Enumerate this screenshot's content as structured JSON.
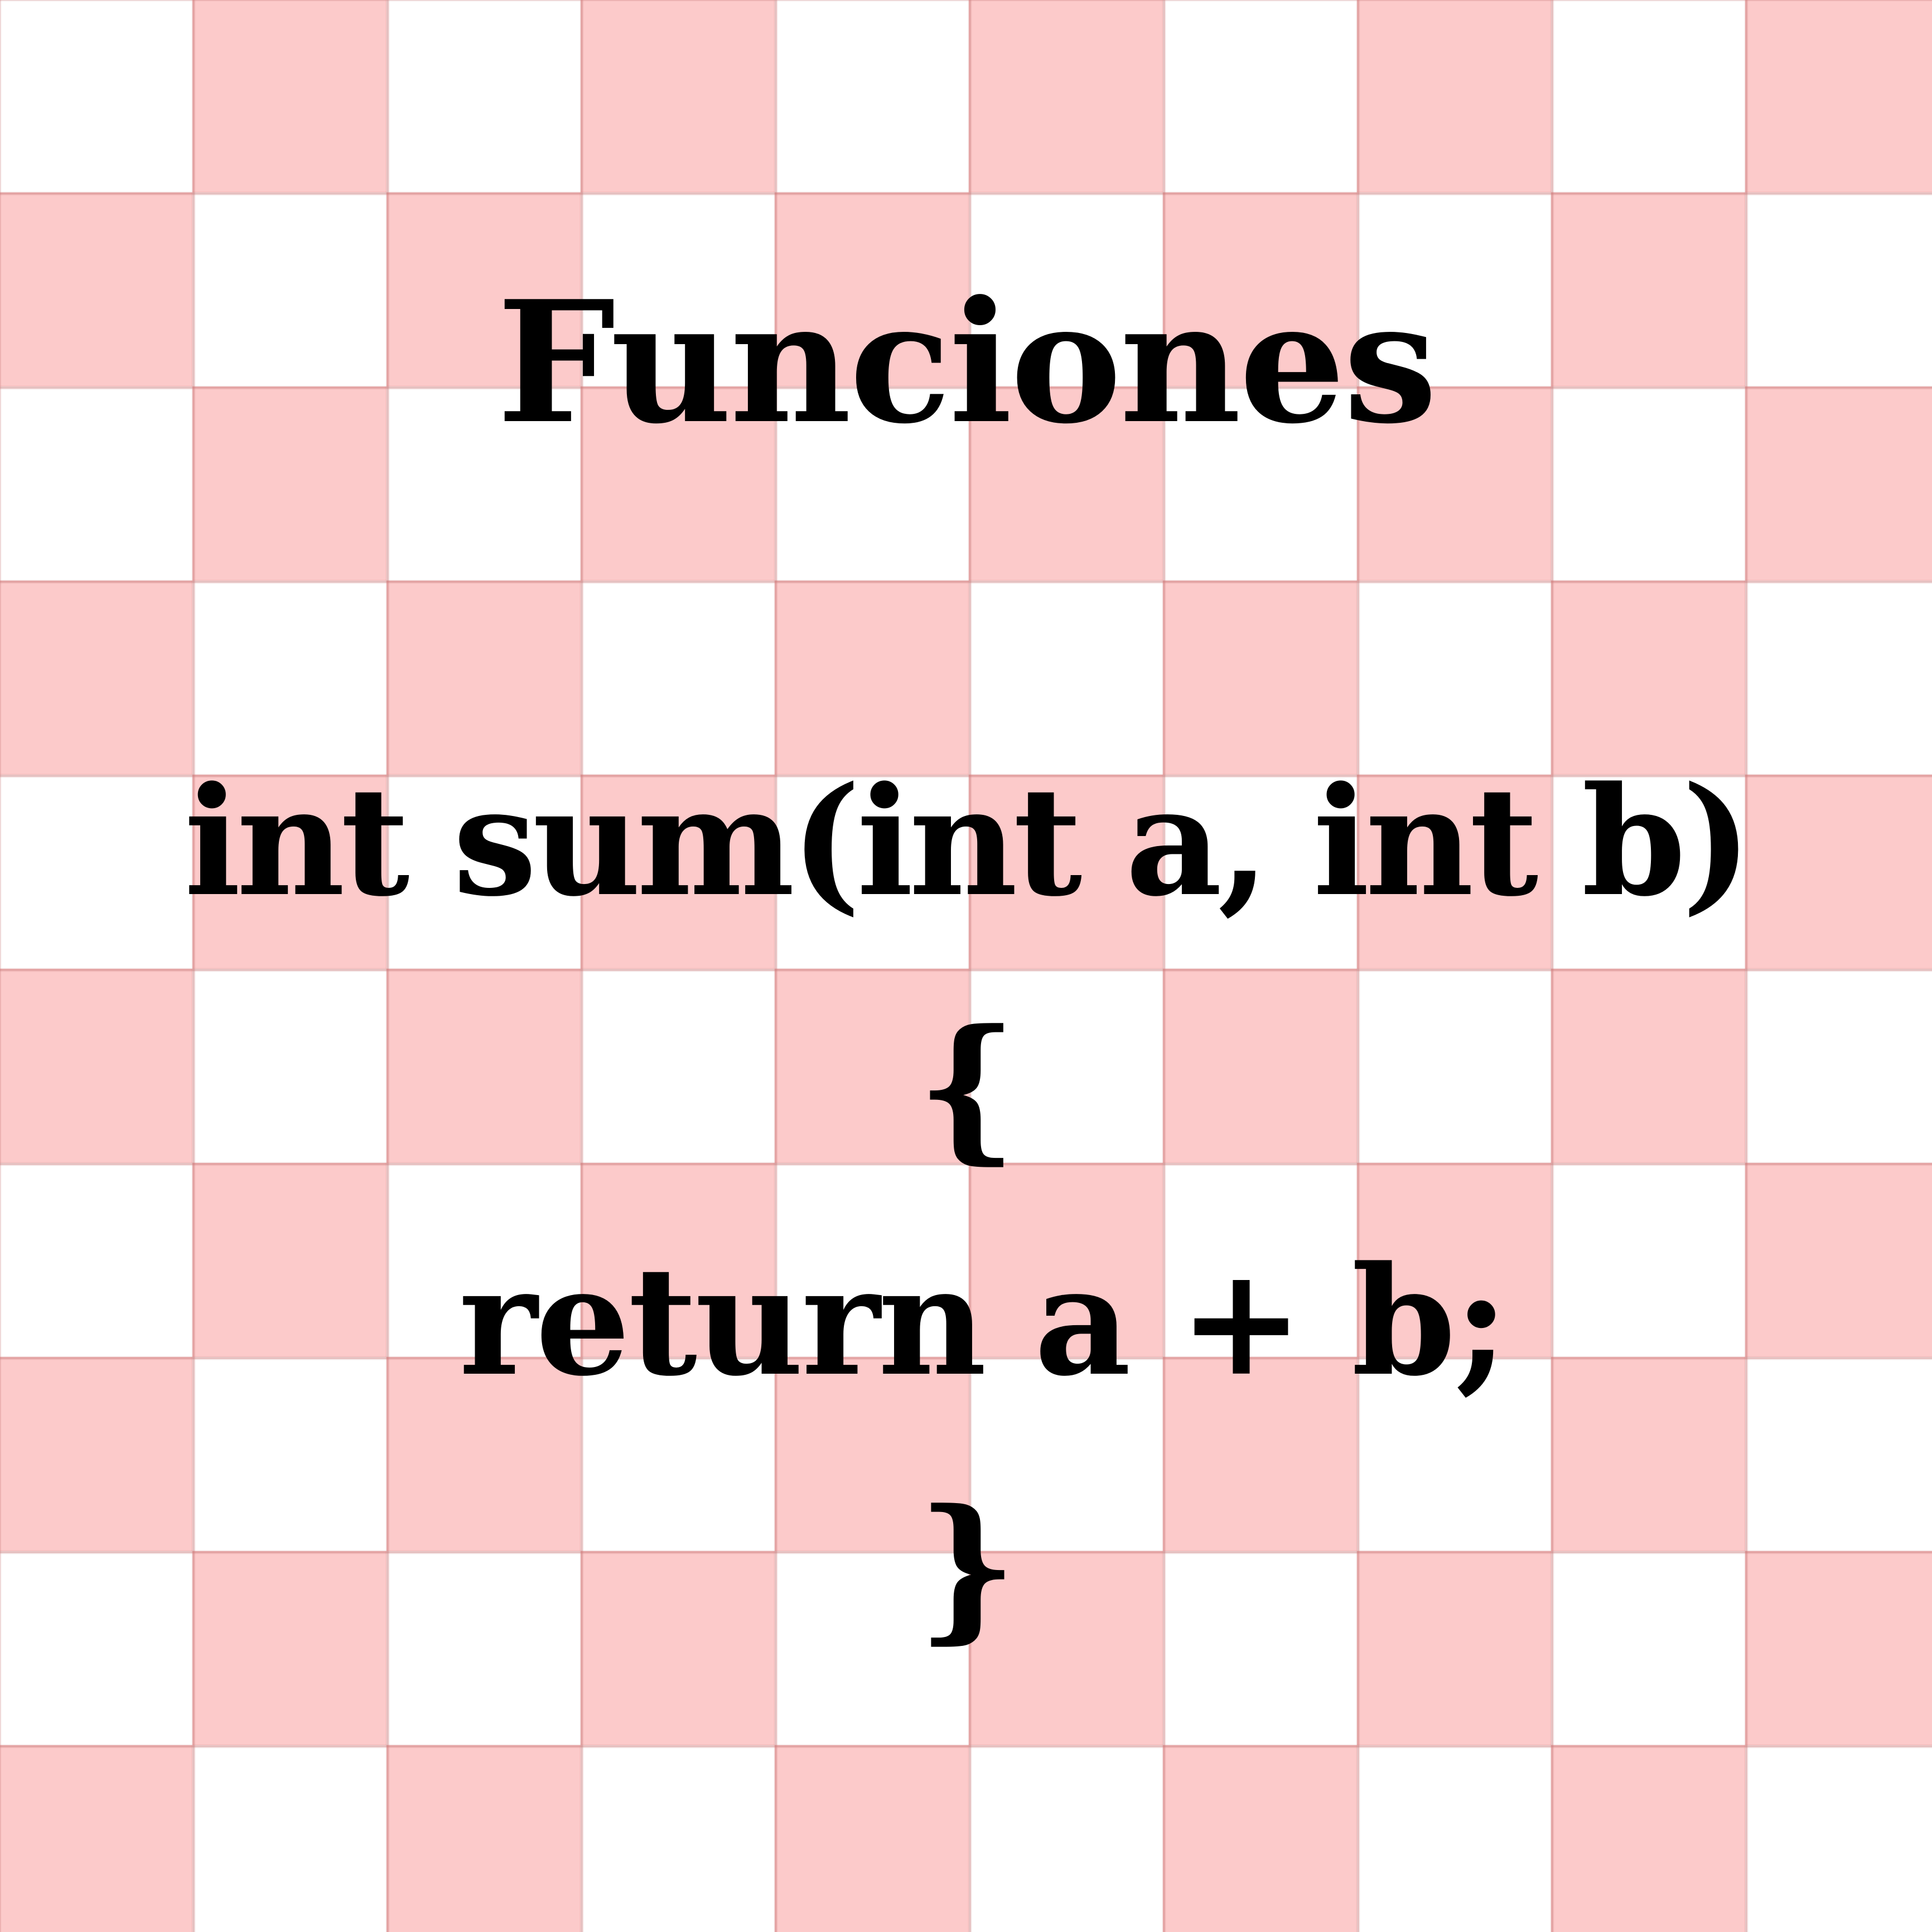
{
  "title": "Funciones",
  "code": {
    "signature": "int sum(int a, int b)",
    "open_brace": "{",
    "body": "return a + b;",
    "close_brace": "}"
  },
  "colors": {
    "checker_pink": "#fccaca",
    "checker_white": "#ffffff",
    "text": "#000000"
  }
}
